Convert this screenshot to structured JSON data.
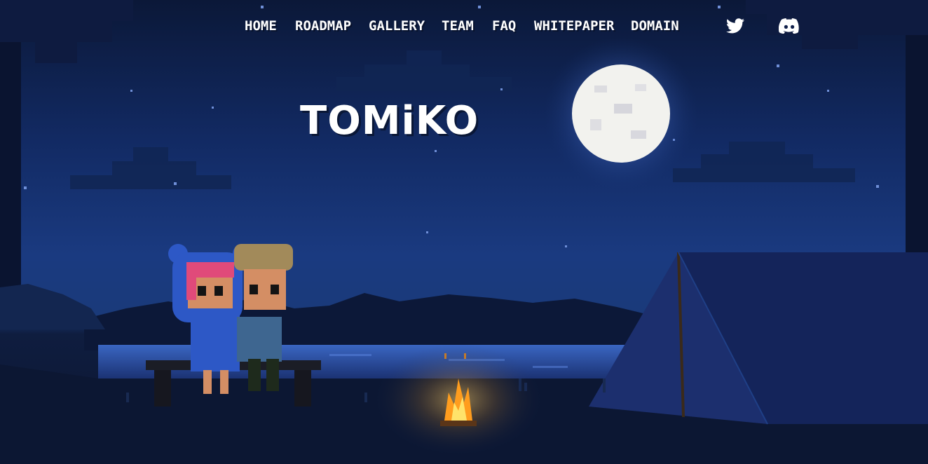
{
  "nav": {
    "items": [
      "HOME",
      "ROADMAP",
      "GALLERY",
      "TEAM",
      "FAQ",
      "WHITEPAPER",
      "DOMAIN"
    ]
  },
  "social": {
    "twitter_icon": "twitter-icon",
    "discord_icon": "discord-icon"
  },
  "brand": {
    "logo_text": "TOMiKO"
  },
  "colors": {
    "sky": "#142e6e",
    "moon": "#f2f2ee",
    "fire": "#ffb628",
    "tent": "#1c2f6e",
    "nav_text": "#ffffff"
  }
}
